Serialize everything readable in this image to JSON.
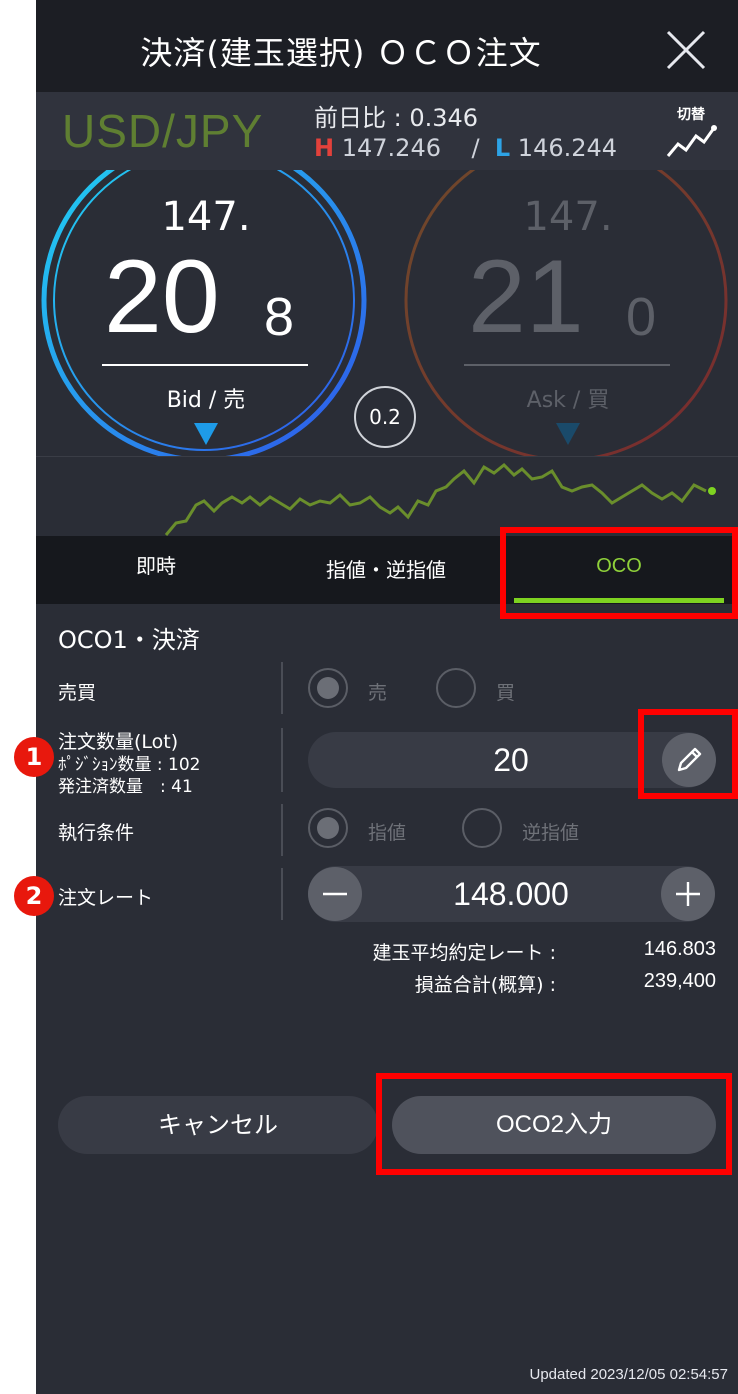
{
  "header": {
    "title": "決済(建玉選択) ＯＣＯ注文",
    "close_icon": "close-icon"
  },
  "pair": {
    "name": "USD/JPY",
    "prev_day": "前日比 : 0.346",
    "high_letter": "H",
    "high": "147.246",
    "sep": "/",
    "low_letter": "L",
    "low": "146.244",
    "switch_label": "切替"
  },
  "bid": {
    "prefix": "147.",
    "big": "20",
    "small": "8",
    "label": "Bid / 売"
  },
  "ask": {
    "prefix": "147.",
    "big": "21",
    "small": "0",
    "label": "Ask / 買"
  },
  "spread": "0.2",
  "tabs": [
    {
      "label": "即時",
      "active": false
    },
    {
      "label": "指値・逆指値",
      "active": false
    },
    {
      "label": "OCO",
      "active": true
    }
  ],
  "form": {
    "section_title": "OCO1・決済",
    "side_label": "売買",
    "side_options": [
      "売",
      "買"
    ],
    "qty_label": "注文数量(Lot)",
    "position_qty_label": "ﾎﾟｼﾞｼｮﾝ数量 : 102",
    "ordered_qty_label": "発注済数量　: 41",
    "qty_value": "20",
    "condition_label": "執行条件",
    "condition_options": [
      "指値",
      "逆指値"
    ],
    "rate_label": "注文レート",
    "rate_value": "148.000",
    "avg_rate_label": "建玉平均約定レート :",
    "avg_rate_value": "146.803",
    "pnl_label": "損益合計(概算) :",
    "pnl_value": "239,400"
  },
  "buttons": {
    "cancel": "キャンセル",
    "next": "OCO2入力"
  },
  "updated": "Updated  2023/12/05 02:54:57",
  "annotations": {
    "badge1": "1",
    "badge2": "2"
  },
  "colors": {
    "accent_green": "#7ed321",
    "pair_green": "#5f7f32",
    "high_red": "#e2413b",
    "low_blue": "#2da3e6",
    "highlight_red": "#ff0000"
  }
}
